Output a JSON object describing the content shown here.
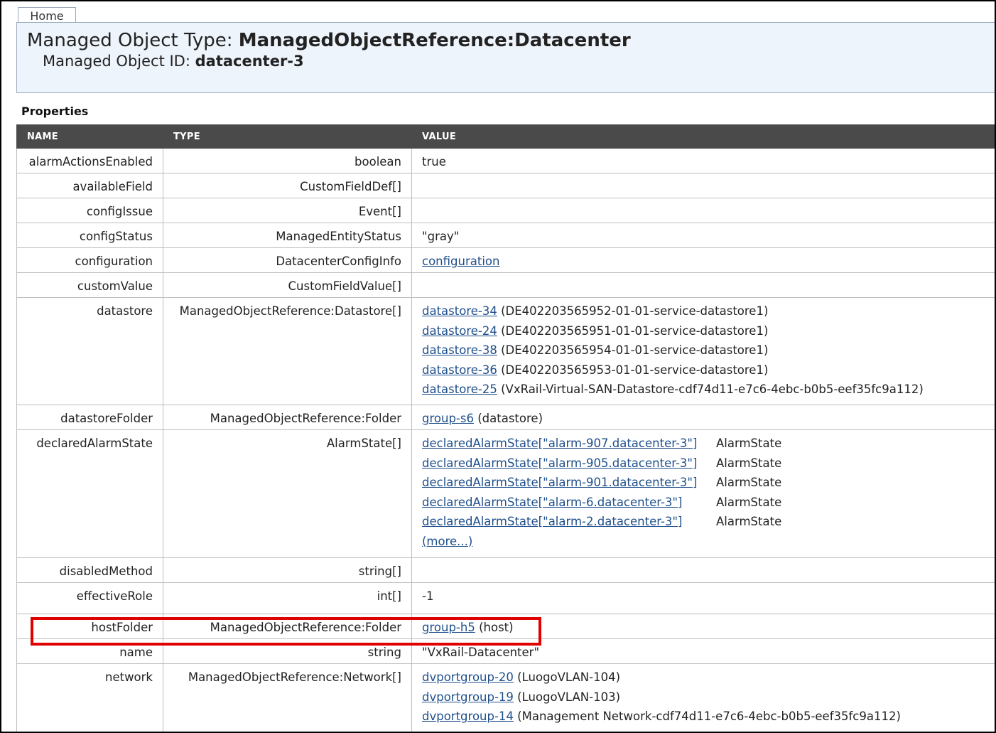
{
  "nav": {
    "home_label": "Home"
  },
  "header": {
    "type_prefix": "Managed Object Type: ",
    "type_value": "ManagedObjectReference:Datacenter",
    "id_prefix": "Managed Object ID: ",
    "id_value": "datacenter-3"
  },
  "properties": {
    "title": "Properties",
    "columns": [
      "NAME",
      "TYPE",
      "VALUE"
    ],
    "rows": {
      "alarmActionsEnabled": {
        "name": "alarmActionsEnabled",
        "type": "boolean",
        "value": "true"
      },
      "availableField": {
        "name": "availableField",
        "type": "CustomFieldDef[]"
      },
      "configIssue": {
        "name": "configIssue",
        "type": "Event[]"
      },
      "configStatus": {
        "name": "configStatus",
        "type": "ManagedEntityStatus",
        "value": "\"gray\""
      },
      "configuration": {
        "name": "configuration",
        "type": "DatacenterConfigInfo",
        "link": "configuration"
      },
      "customValue": {
        "name": "customValue",
        "type": "CustomFieldValue[]"
      },
      "datastore": {
        "name": "datastore",
        "type": "ManagedObjectReference:Datastore[]",
        "items": [
          {
            "link": "datastore-34",
            "text": " (DE402203565952-01-01-service-datastore1)"
          },
          {
            "link": "datastore-24",
            "text": " (DE402203565951-01-01-service-datastore1)"
          },
          {
            "link": "datastore-38",
            "text": " (DE402203565954-01-01-service-datastore1)"
          },
          {
            "link": "datastore-36",
            "text": " (DE402203565953-01-01-service-datastore1)"
          },
          {
            "link": "datastore-25",
            "text": " (VxRail-Virtual-SAN-Datastore-cdf74d11-e7c6-4ebc-b0b5-eef35fc9a112)"
          }
        ]
      },
      "datastoreFolder": {
        "name": "datastoreFolder",
        "type": "ManagedObjectReference:Folder",
        "link": "group-s6",
        "text": " (datastore)"
      },
      "declaredAlarmState": {
        "name": "declaredAlarmState",
        "type": "AlarmState[]",
        "items": [
          {
            "link": "declaredAlarmState[\"alarm-907.datacenter-3\"]",
            "type": "AlarmState"
          },
          {
            "link": "declaredAlarmState[\"alarm-905.datacenter-3\"]",
            "type": "AlarmState"
          },
          {
            "link": "declaredAlarmState[\"alarm-901.datacenter-3\"]",
            "type": "AlarmState"
          },
          {
            "link": "declaredAlarmState[\"alarm-6.datacenter-3\"]",
            "type": "AlarmState"
          },
          {
            "link": "declaredAlarmState[\"alarm-2.datacenter-3\"]",
            "type": "AlarmState"
          }
        ],
        "more_label": "(more...)"
      },
      "disabledMethod": {
        "name": "disabledMethod",
        "type": "string[]"
      },
      "effectiveRole": {
        "name": "effectiveRole",
        "type": "int[]",
        "value": "-1"
      },
      "hostFolder": {
        "name": "hostFolder",
        "type": "ManagedObjectReference:Folder",
        "link": "group-h5",
        "text": " (host)"
      },
      "name": {
        "name": "name",
        "type": "string",
        "value": "\"VxRail-Datacenter\""
      },
      "network": {
        "name": "network",
        "type": "ManagedObjectReference:Network[]",
        "items": [
          {
            "link": "dvportgroup-20",
            "text": " (LuogoVLAN-104)"
          },
          {
            "link": "dvportgroup-19",
            "text": " (LuogoVLAN-103)"
          },
          {
            "link": "dvportgroup-14",
            "text": " (Management Network-cdf74d11-e7c6-4ebc-b0b5-eef35fc9a112)"
          }
        ]
      }
    }
  },
  "colors": {
    "header_bg": "#eef4fb",
    "table_header_bg": "#4a4a4a",
    "link": "#1f4f8b",
    "highlight": "#e00000"
  }
}
